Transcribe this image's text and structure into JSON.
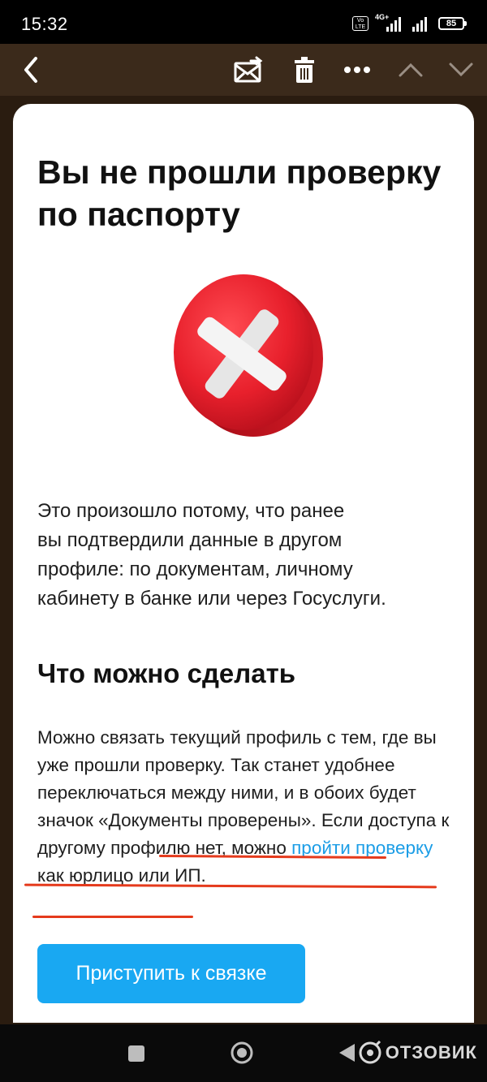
{
  "status_bar": {
    "time": "15:32",
    "volte_label": "Vo LTE",
    "network_type": "4G+",
    "battery_level": "85"
  },
  "toolbar": {
    "icons": [
      "back-icon",
      "mail-move-icon",
      "trash-icon",
      "more-icon",
      "chevron-up-icon",
      "chevron-down-icon"
    ]
  },
  "content": {
    "title": "Вы не прошли проверку по паспорту",
    "status_icon": "red-x-cross-icon",
    "explanation": "Это произошло потому, что ранее\nвы подтвердили данные в другом\nпрофиле: по документам, личному\nкабинету в банке или через Госуслуги.",
    "section_heading": "Что можно сделать",
    "body_part1": "Можно связать текущий профиль с тем, где вы уже прошли проверку. Так станет удобнее переключаться между ними, и в обоих будет значок «Документы проверены». ",
    "body_part2": "Если доступа к другому профилю нет, можно ",
    "body_link": "пройти проверку",
    "body_part3": " как юрлицо или ИП.",
    "cta_label": "Приступить к связке"
  },
  "nav_bar": {
    "icons": [
      "recent-apps-icon",
      "home-icon",
      "back-triangle-icon"
    ],
    "watermark": "ОТЗОВИК"
  },
  "colors": {
    "toolbar_bg": "#3b2a1b",
    "accent": "#19a8f2",
    "link": "#1b9de6",
    "underline_annotation": "#e53a1c",
    "cross_red": "#e8202c"
  }
}
